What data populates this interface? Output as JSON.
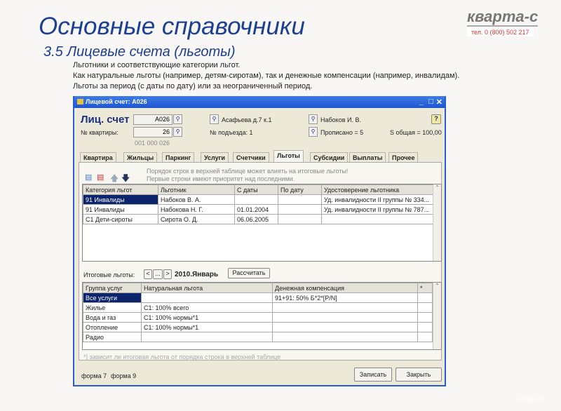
{
  "slide": {
    "title": "Основные справочники",
    "subtitle": "3.5  Лицевые счета (льготы)",
    "lines": [
      "Льготники и соответствующие категории льгот.",
      "Как натуральные льготы (например, детям-сиротам), так и денежные компенсации (например, инвалидам).",
      "Льготы за период (с даты по дату) или за неограниченный период."
    ],
    "logo": "кварта-с",
    "phone": "тел. 0 (800) 502 217",
    "slide_number": "слайд 40"
  },
  "window": {
    "title": "Лицевой счет: А026",
    "minimize": "_",
    "maximize": "□",
    "close": "✕"
  },
  "header": {
    "account_label": "Лиц. счет",
    "account_value": "А026",
    "apartment_label": "№ квартиры:",
    "apartment_value": "26",
    "code": "001 000 026",
    "address": "Асафьева д.7 к.1",
    "entrance": "№ подъезда:  1",
    "owner": "Набоков И. В.",
    "registered": "Прописано = 5",
    "area": "S общая = 100,00",
    "help": "?"
  },
  "tabs": [
    "Квартира",
    "Жильцы",
    "Паркинг",
    "Услуги",
    "Счетчики",
    "Льготы",
    "Субсидии",
    "Выплаты",
    "Прочее"
  ],
  "hint": [
    "Порядок строк в верхней таблице может влиять на итоговые льготы!",
    "Первые строки имеют приоритет над последними."
  ],
  "benefits": {
    "columns": [
      "Категория льгот",
      "Льготник",
      "С даты",
      "По дату",
      "Удостоверение льготника"
    ],
    "rows": [
      [
        "91   Инвалиды",
        "Набоков В. А.",
        "",
        "",
        "Уд. инвалидности II группы № 334..."
      ],
      [
        "91   Инвалиды",
        "Набокова Н. Г.",
        "01.01.2004",
        "",
        "Уд. инвалидности II группы № 787..."
      ],
      [
        "С1   Дети-сироты",
        "Сирота О. Д.",
        "06.06.2005",
        "",
        ""
      ]
    ]
  },
  "totals": {
    "label": "Итоговые льготы:",
    "prev": "<",
    "dots": "...",
    "next": ">",
    "period": "2010.Январь",
    "calc": "Рассчитать",
    "columns": [
      "Группа услуг",
      "Натуральная льгота",
      "Денежная компенсация",
      "*"
    ],
    "rows": [
      [
        "Все услуги",
        "",
        "91+91:  50% Б*2*[P/N]",
        ""
      ],
      [
        "Жилье",
        "С1:  100% всего",
        "",
        ""
      ],
      [
        "Вода и газ",
        "С1:  100% нормы*1",
        "",
        ""
      ],
      [
        "Отопление",
        "С1:  100% нормы*1",
        "",
        ""
      ],
      [
        "Радио",
        "",
        "",
        ""
      ]
    ],
    "note": "*] зависит ли итоговая льгота от порядка строка в верхней таблице"
  },
  "footer": {
    "form7": "форма 7",
    "form9": "форма 9",
    "save": "Записать",
    "close": "Закрыть"
  }
}
